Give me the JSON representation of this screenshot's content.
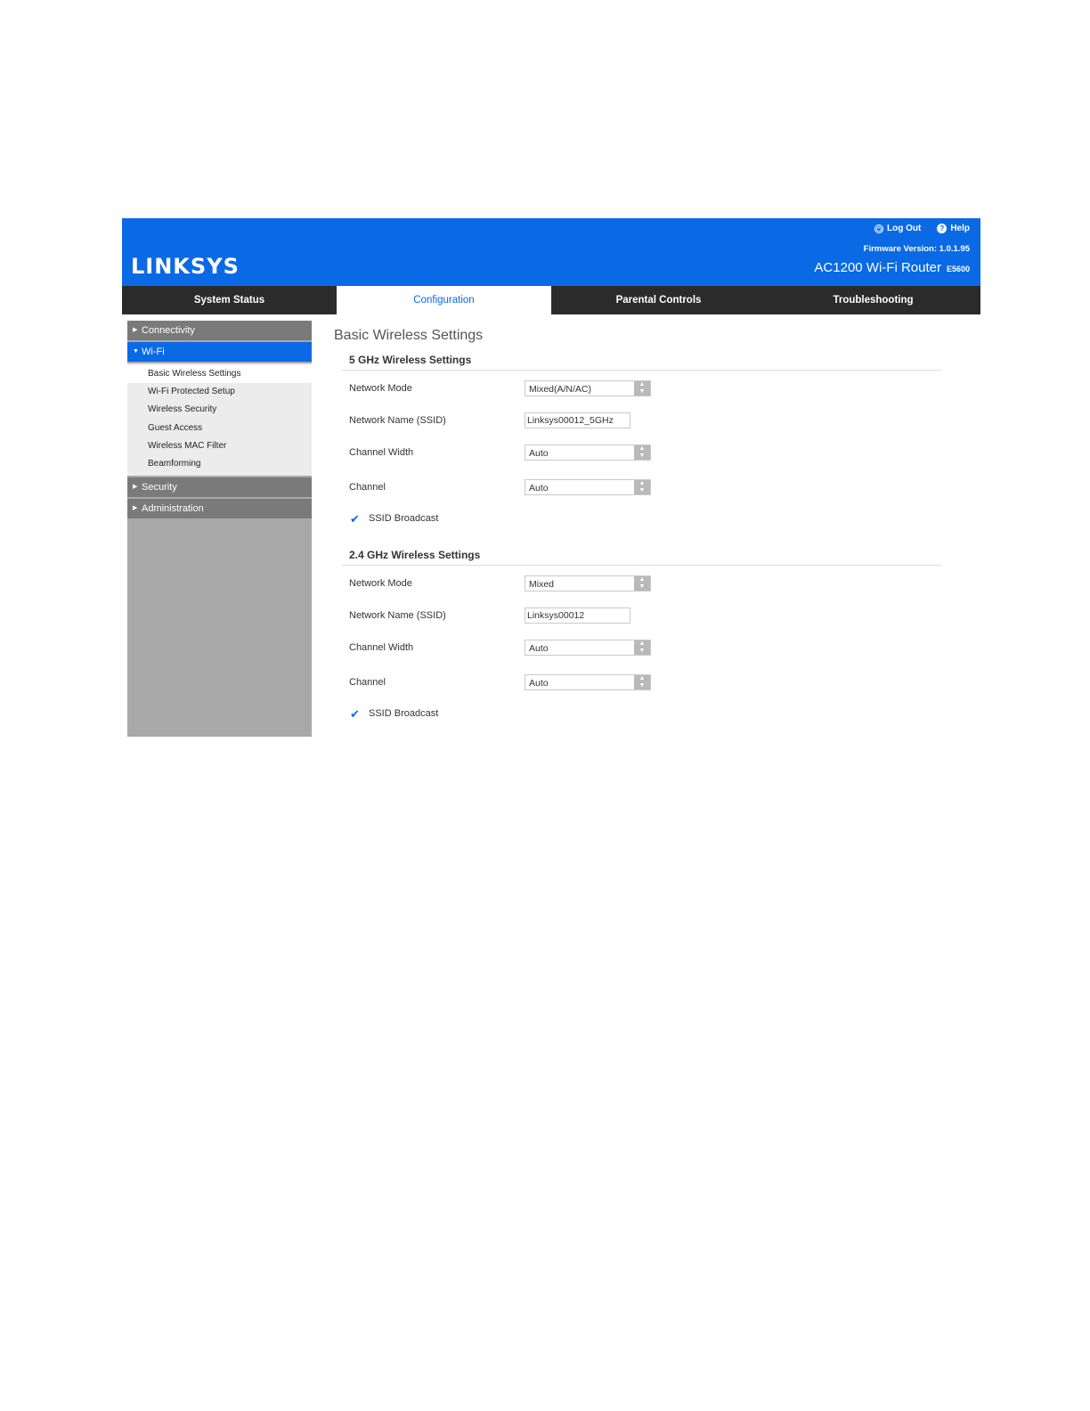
{
  "header": {
    "brand": "LINKSYS",
    "logout_label": "Log Out",
    "help_label": "Help",
    "firmware_label": "Firmware Version:",
    "firmware_value": "1.0.1.95",
    "model_name": "AC1200 Wi-Fi Router",
    "model_code": "E5600",
    "bg_color": "#0a6ae6"
  },
  "tabs": [
    {
      "label": "System Status",
      "active": false
    },
    {
      "label": "Configuration",
      "active": true
    },
    {
      "label": "Parental Controls",
      "active": false
    },
    {
      "label": "Troubleshooting",
      "active": false
    }
  ],
  "sidebar": {
    "sections": [
      {
        "label": "Connectivity",
        "expanded": false
      },
      {
        "label": "Wi-Fi",
        "expanded": true
      },
      {
        "label": "Security",
        "expanded": false
      },
      {
        "label": "Administration",
        "expanded": false
      }
    ],
    "wifi_items": [
      {
        "label": "Basic Wireless Settings",
        "active": true
      },
      {
        "label": "Wi-Fi Protected Setup",
        "active": false
      },
      {
        "label": "Wireless Security",
        "active": false
      },
      {
        "label": "Guest Access",
        "active": false
      },
      {
        "label": "Wireless MAC Filter",
        "active": false
      },
      {
        "label": "Beamforming",
        "active": false
      }
    ]
  },
  "main": {
    "page_title": "Basic Wireless Settings",
    "band5": {
      "title": "5 GHz Wireless Settings",
      "network_mode_label": "Network Mode",
      "network_mode_value": "Mixed(A/N/AC)",
      "ssid_label": "Network Name (SSID)",
      "ssid_value": "Linksys00012_5GHz",
      "channel_width_label": "Channel Width",
      "channel_width_value": "Auto",
      "channel_label": "Channel",
      "channel_value": "Auto",
      "ssid_broadcast_label": "SSID Broadcast",
      "ssid_broadcast_checked": true
    },
    "band24": {
      "title": "2.4 GHz Wireless Settings",
      "network_mode_label": "Network Mode",
      "network_mode_value": "Mixed",
      "ssid_label": "Network Name (SSID)",
      "ssid_value": "Linksys00012",
      "channel_width_label": "Channel Width",
      "channel_width_value": "Auto",
      "channel_label": "Channel",
      "channel_value": "Auto",
      "ssid_broadcast_label": "SSID Broadcast",
      "ssid_broadcast_checked": true
    }
  }
}
